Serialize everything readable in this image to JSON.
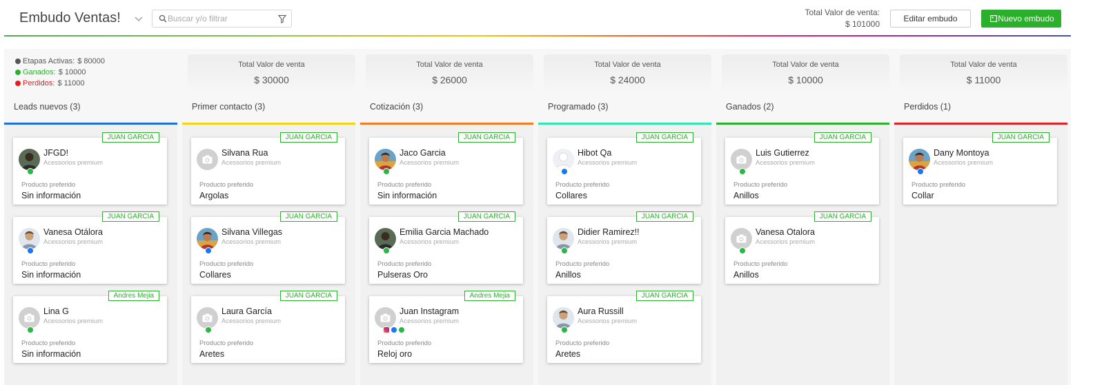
{
  "header": {
    "title": "Embudo Ventas!",
    "search_placeholder": "Buscar y/o filtrar",
    "total_label": "Total Valor de venta:",
    "total_value": "$ 101000",
    "edit_label": "Editar embudo",
    "new_label": "Nuevo embudo",
    "accent_color": "#2bb02b"
  },
  "legend": {
    "active": {
      "label": "Etapas Activas:",
      "value": "$ 80000",
      "color": "#555555"
    },
    "won": {
      "label": "Ganados:",
      "value": "$ 10000",
      "color": "#2bb02b"
    },
    "lost": {
      "label": "Perdidos:",
      "value": "$ 11000",
      "color": "#e02020"
    }
  },
  "columns": [
    {
      "total_label": "",
      "total_value": "",
      "stage": "Leads nuevos (3)",
      "color": "#1e6fd9",
      "cards": [
        {
          "owner": "JUAN GARCIA",
          "name": "JFGD!",
          "company": "Acessorios premium",
          "avatar": "person-dark",
          "channels": [
            "whatsapp"
          ],
          "product_label": "Producto preferido",
          "product": "Sin información"
        },
        {
          "owner": "JUAN GARCIA",
          "name": "Vanesa Otálora",
          "company": "Acessorios premium",
          "avatar": "person-light",
          "channels": [
            "messenger"
          ],
          "product_label": "Producto preferido",
          "product": "Sin información"
        },
        {
          "owner": "Andres Mejia",
          "name": "Lina G",
          "company": "Acessorios premium",
          "avatar": "camera-placeholder",
          "channels": [
            "whatsapp"
          ],
          "product_label": "Producto preferido",
          "product": "Sin información"
        }
      ]
    },
    {
      "total_label": "Total Valor de venta",
      "total_value": "$ 30000",
      "stage": "Primer contacto (3)",
      "color": "#f5d21a",
      "cards": [
        {
          "owner": "JUAN GARCIA",
          "name": "Silvana Rua",
          "company": "Acessorios premium",
          "avatar": "camera-placeholder",
          "channels": [],
          "product_label": "Producto preferido",
          "product": "Argolas"
        },
        {
          "owner": "JUAN GARCIA",
          "name": "Silvana Villegas",
          "company": "Acessorios premium",
          "avatar": "person-colorful",
          "channels": [
            "messenger"
          ],
          "product_label": "Producto preferido",
          "product": "Collares"
        },
        {
          "owner": "JUAN GARCIA",
          "name": "Laura García",
          "company": "Acessorios premium",
          "avatar": "camera-placeholder",
          "channels": [
            "whatsapp"
          ],
          "product_label": "Producto preferido",
          "product": "Aretes"
        }
      ]
    },
    {
      "total_label": "Total Valor de venta",
      "total_value": "$ 26000",
      "stage": "Cotización (3)",
      "color": "#f07c22",
      "cards": [
        {
          "owner": "JUAN GARCIA",
          "name": "Jaco Garcia",
          "company": "Acessorios premium",
          "avatar": "person-colorful",
          "channels": [
            "whatsapp"
          ],
          "product_label": "Producto preferido",
          "product": "Sin información"
        },
        {
          "owner": "JUAN GARCIA",
          "name": "Emilia Garcia Machado",
          "company": "Acessorios premium",
          "avatar": "person-dark",
          "channels": [
            "whatsapp"
          ],
          "product_label": "Producto preferido",
          "product": "Pulseras Oro"
        },
        {
          "owner": "Andres Mejia",
          "name": "Juan Instagram",
          "company": "Acessorios premium",
          "avatar": "camera-placeholder",
          "channels": [
            "instagram",
            "messenger",
            "whatsapp"
          ],
          "product_label": "Producto preferido",
          "product": "Reloj oro"
        }
      ]
    },
    {
      "total_label": "Total Valor de venta",
      "total_value": "$ 24000",
      "stage": "Programado (3)",
      "color": "#2ee6b0",
      "cards": [
        {
          "owner": "JUAN GARCIA",
          "name": "Hibot Qa",
          "company": "Acessorios premium",
          "avatar": "person-blank",
          "channels": [
            "messenger"
          ],
          "product_label": "Producto preferido",
          "product": "Collares"
        },
        {
          "owner": "JUAN GARCIA",
          "name": "Didier Ramirez!!",
          "company": "Acessorios premium",
          "avatar": "person-light",
          "channels": [
            "whatsapp"
          ],
          "product_label": "Producto preferido",
          "product": "Anillos"
        },
        {
          "owner": "JUAN GARCIA",
          "name": "Aura Russill",
          "company": "Acessorios premium",
          "avatar": "person-light",
          "channels": [
            "whatsapp"
          ],
          "product_label": "Producto preferido",
          "product": "Aretes"
        }
      ]
    },
    {
      "total_label": "Total Valor de venta",
      "total_value": "$ 10000",
      "stage": "Ganados (2)",
      "color": "#2bb02b",
      "cards": [
        {
          "owner": "JUAN GARCIA",
          "name": "Luis Gutierrez",
          "company": "Acessorios premium",
          "avatar": "camera-placeholder",
          "channels": [
            "whatsapp"
          ],
          "product_label": "Producto preferido",
          "product": "Anillos"
        },
        {
          "owner": "JUAN GARCIA",
          "name": "Vanesa Otalora",
          "company": "Acessorios premium",
          "avatar": "camera-placeholder",
          "channels": [
            "whatsapp"
          ],
          "product_label": "Producto preferido",
          "product": "Anillos"
        }
      ]
    },
    {
      "total_label": "Total Valor de venta",
      "total_value": "$ 11000",
      "stage": "Perdidos (1)",
      "color": "#e02020",
      "cards": [
        {
          "owner": "JUAN GARCIA",
          "name": "Dany Montoya",
          "company": "Acessorios premium",
          "avatar": "person-colorful",
          "channels": [
            "messenger"
          ],
          "product_label": "Producto preferido",
          "product": "Collar"
        }
      ]
    }
  ]
}
